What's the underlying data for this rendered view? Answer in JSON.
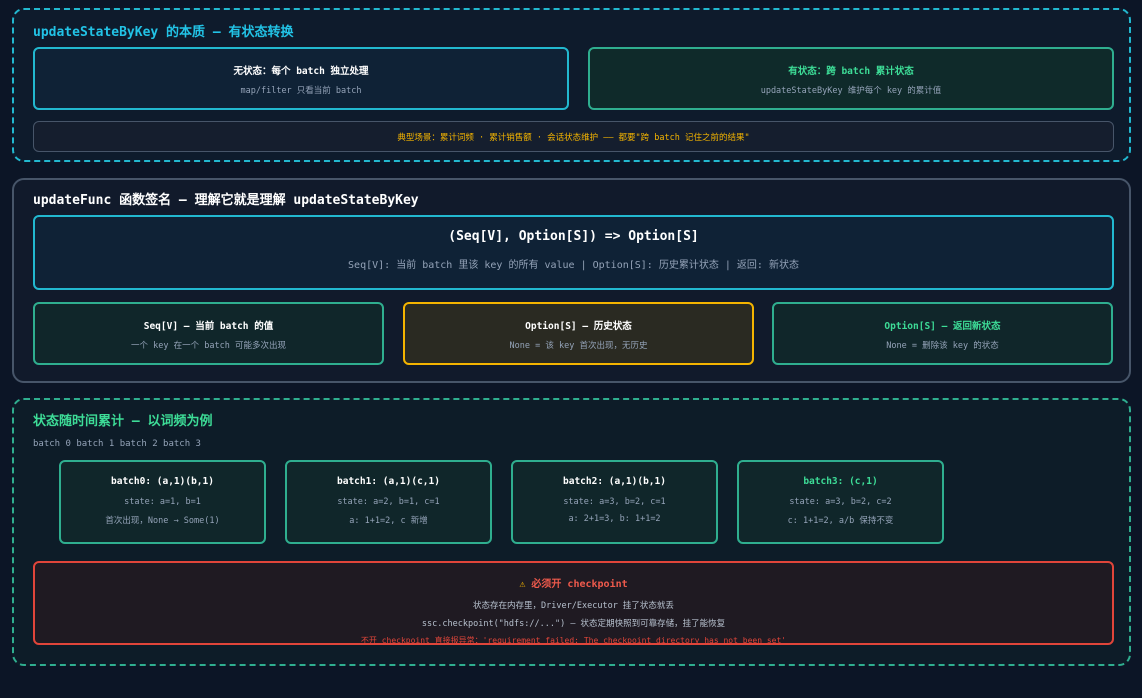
{
  "section1": {
    "title": "updateStateByKey 的本质 — 有状态转换",
    "stateless": {
      "title": "无状态：每个 batch 独立处理",
      "desc": "map/filter 只看当前 batch"
    },
    "stateful": {
      "title": "有状态：跨 batch 累计状态",
      "desc": "updateStateByKey 维护每个 key 的累计值"
    },
    "scenario": "典型场景：累计词频 · 累计销售额 · 会话状态维护 —— 都要\"跨 batch 记住之前的结果\""
  },
  "section2": {
    "title": "updateFunc 函数签名 — 理解它就是理解 updateStateByKey",
    "signature": "(Seq[V], Option[S]) => Option[S]",
    "signature_desc": "Seq[V]: 当前 batch 里该 key 的所有 value | Option[S]: 历史累计状态 | 返回: 新状态",
    "params": [
      {
        "title": "Seq[V] — 当前 batch 的值",
        "desc": "一个 key 在一个 batch 可能多次出现"
      },
      {
        "title": "Option[S] — 历史状态",
        "desc": "None = 该 key 首次出现，无历史"
      },
      {
        "title": "Option[S] — 返回新状态",
        "desc": "None = 删除该 key 的状态"
      }
    ]
  },
  "section3": {
    "title": "状态随时间累计 — 以词频为例",
    "timeline": "batch 0 batch 1 batch 2 batch 3",
    "batches": [
      {
        "title": "batch0: (a,1)(b,1)",
        "state": "state: a=1, b=1",
        "note": "首次出现，None → Some(1)"
      },
      {
        "title": "batch1: (a,1)(c,1)",
        "state": "state: a=2, b=1, c=1",
        "note": "a: 1+1=2, c 新增"
      },
      {
        "title": "batch2: (a,1)(b,1)",
        "state": "state: a=3, b=2, c=1",
        "note": "a: 2+1=3, b: 1+1=2"
      },
      {
        "title": "batch3: (c,1)",
        "state": "state: a=3, b=2, c=2",
        "note": "c: 1+1=2, a/b 保持不变"
      }
    ],
    "warning": {
      "title": "必须开 checkpoint",
      "line1": "状态存在内存里，Driver/Executor 挂了状态就丢",
      "line2": "ssc.checkpoint(\"hdfs://...\") — 状态定期快照到可靠存储，挂了能恢复",
      "line3": "不开 checkpoint 直接报异常：'requirement failed: The checkpoint directory has not been set'"
    }
  },
  "colors": {
    "cyan": "#22b8cf",
    "green": "#2fae8f",
    "amber": "#f4b400",
    "red": "#e0453a"
  }
}
